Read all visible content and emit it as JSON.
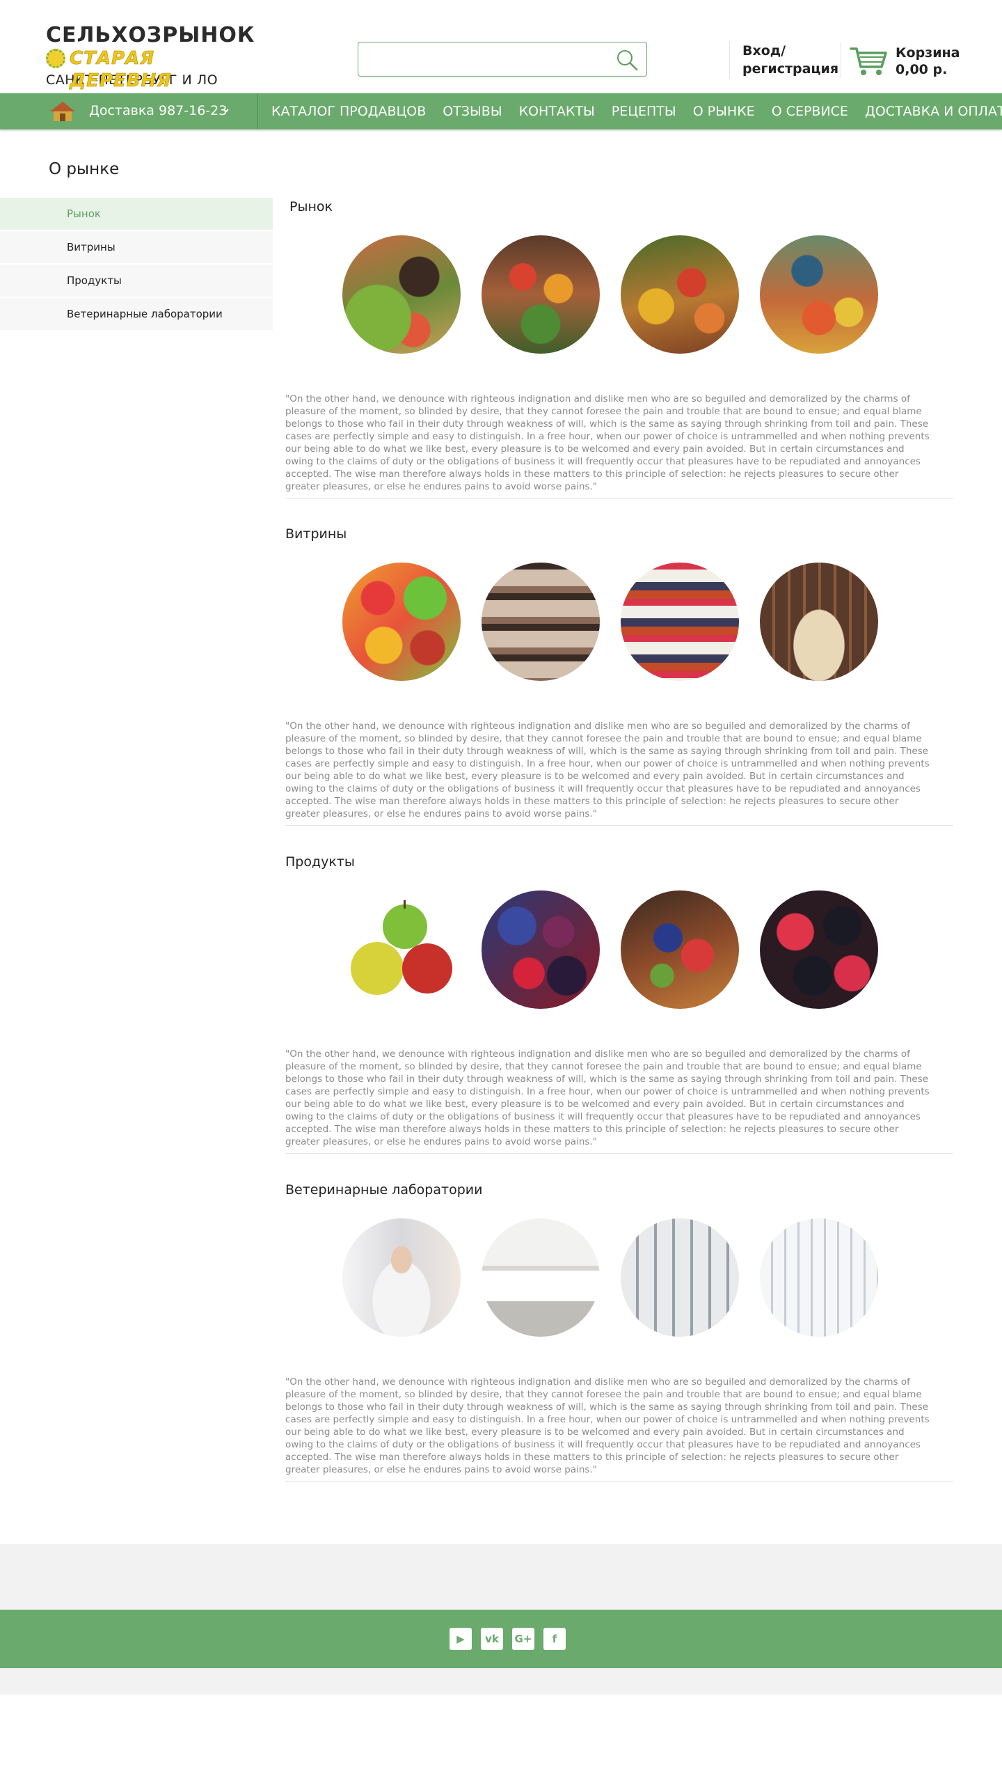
{
  "header": {
    "logo": {
      "line1": "СЕЛЬХОЗРЫНОК",
      "line2": "СТАРАЯ ДЕРЕВНЯ",
      "line3": "САНКТ-ПЕТЕРБУРГ И ЛО"
    },
    "search": {
      "value": "",
      "placeholder": ""
    },
    "login": {
      "line1": "Вход/",
      "line2": "регистрация"
    },
    "cart": {
      "label": "Корзина",
      "amount": "0,00 р."
    }
  },
  "nav": {
    "delivery_label": "Доставка  987-16-23",
    "links": [
      "КАТАЛОГ ПРОДАВЦОВ",
      "ОТЗЫВЫ",
      "КОНТАКТЫ",
      "РЕЦЕПТЫ",
      "О РЫНКЕ",
      "О СЕРВИСЕ",
      "ДОСТАВКА И ОПЛАТА"
    ]
  },
  "page_title": "О рынке",
  "sidebar": {
    "items": [
      {
        "label": "Рынок",
        "active": true
      },
      {
        "label": "Витрины",
        "active": false
      },
      {
        "label": "Продукты",
        "active": false
      },
      {
        "label": "Ветеринарные лаборатории",
        "active": false
      }
    ]
  },
  "sections": [
    {
      "title": "Рынок",
      "images": [
        "market-greens-photo",
        "market-produce-photo",
        "market-fruit-stall-photo",
        "market-crowd-photo"
      ],
      "text": "\"On the other hand, we denounce with righteous indignation and dislike men who are so beguiled and demoralized by the charms of pleasure of the moment, so blinded by desire, that they cannot foresee the pain and trouble that are bound to ensue; and equal blame belongs to those who fail in their duty through weakness of will, which is the same as saying through shrinking from toil and pain. These cases are perfectly simple and easy to distinguish. In a free hour, when our power of choice is untrammelled and when nothing prevents our being able to do what we like best, every pleasure is to be welcomed and every pain avoided. But in certain circumstances and owing to the claims of duty or the obligations of business it will frequently occur that pleasures have to be repudiated and annoyances accepted. The wise man therefore always holds in these matters to this principle of selection: he rejects pleasures to secure other greater pleasures, or else he endures pains to avoid worse pains.\""
    },
    {
      "title": "Витрины",
      "images": [
        "candy-display-photo",
        "bakery-shelves-photo",
        "grocery-shelves-photo",
        "shop-window-photo"
      ],
      "text": "\"On the other hand, we denounce with righteous indignation and dislike men who are so beguiled and demoralized by the charms of pleasure of the moment, so blinded by desire, that they cannot foresee the pain and trouble that are bound to ensue; and equal blame belongs to those who fail in their duty through weakness of will, which is the same as saying through shrinking from toil and pain. These cases are perfectly simple and easy to distinguish. In a free hour, when our power of choice is untrammelled and when nothing prevents our being able to do what we like best, every pleasure is to be welcomed and every pain avoided. But in certain circumstances and owing to the claims of duty or the obligations of business it will frequently occur that pleasures have to be repudiated and annoyances accepted. The wise man therefore always holds in these matters to this principle of selection: he rejects pleasures to secure other greater pleasures, or else he endures pains to avoid worse pains.\""
    },
    {
      "title": "Продукты",
      "images": [
        "apples-photo",
        "berries-mix-photo",
        "berry-tart-photo",
        "raspberries-photo"
      ],
      "text": "\"On the other hand, we denounce with righteous indignation and dislike men who are so beguiled and demoralized by the charms of pleasure of the moment, so blinded by desire, that they cannot foresee the pain and trouble that are bound to ensue; and equal blame belongs to those who fail in their duty through weakness of will, which is the same as saying through shrinking from toil and pain. These cases are perfectly simple and easy to distinguish. In a free hour, when our power of choice is untrammelled and when nothing prevents our being able to do what we like best, every pleasure is to be welcomed and every pain avoided. But in certain circumstances and owing to the claims of duty or the obligations of business it will frequently occur that pleasures have to be repudiated and annoyances accepted. The wise man therefore always holds in these matters to this principle of selection: he rejects pleasures to secure other greater pleasures, or else he endures pains to avoid worse pains.\""
    },
    {
      "title": "Ветеринарные лаборатории",
      "images": [
        "lab-worker-photo",
        "lab-room-photo",
        "lab-equipment-photo",
        "lab-glassware-photo"
      ],
      "text": "\"On the other hand, we denounce with righteous indignation and dislike men who are so beguiled and demoralized by the charms of pleasure of the moment, so blinded by desire, that they cannot foresee the pain and trouble that are bound to ensue; and equal blame belongs to those who fail in their duty through weakness of will, which is the same as saying through shrinking from toil and pain. These cases are perfectly simple and easy to distinguish. In a free hour, when our power of choice is untrammelled and when nothing prevents our being able to do what we like best, every pleasure is to be welcomed and every pain avoided. But in certain circumstances and owing to the claims of duty or the obligations of business it will frequently occur that pleasures have to be repudiated and annoyances accepted. The wise man therefore always holds in these matters to this principle of selection: he rejects pleasures to secure other greater pleasures, or else he endures pains to avoid worse pains.\""
    }
  ],
  "footer": {
    "social": [
      {
        "icon": "youtube-icon",
        "glyph": "▶"
      },
      {
        "icon": "vk-icon",
        "glyph": "vk"
      },
      {
        "icon": "google-plus-icon",
        "glyph": "G+"
      },
      {
        "icon": "facebook-icon",
        "glyph": "f"
      }
    ]
  },
  "colors": {
    "brand_green": "#6aaa6c",
    "active_bg": "#e8f3e8",
    "active_text": "#5ca25f",
    "logo_yellow": "#f0c419",
    "body_text": "#8a8a8a"
  }
}
